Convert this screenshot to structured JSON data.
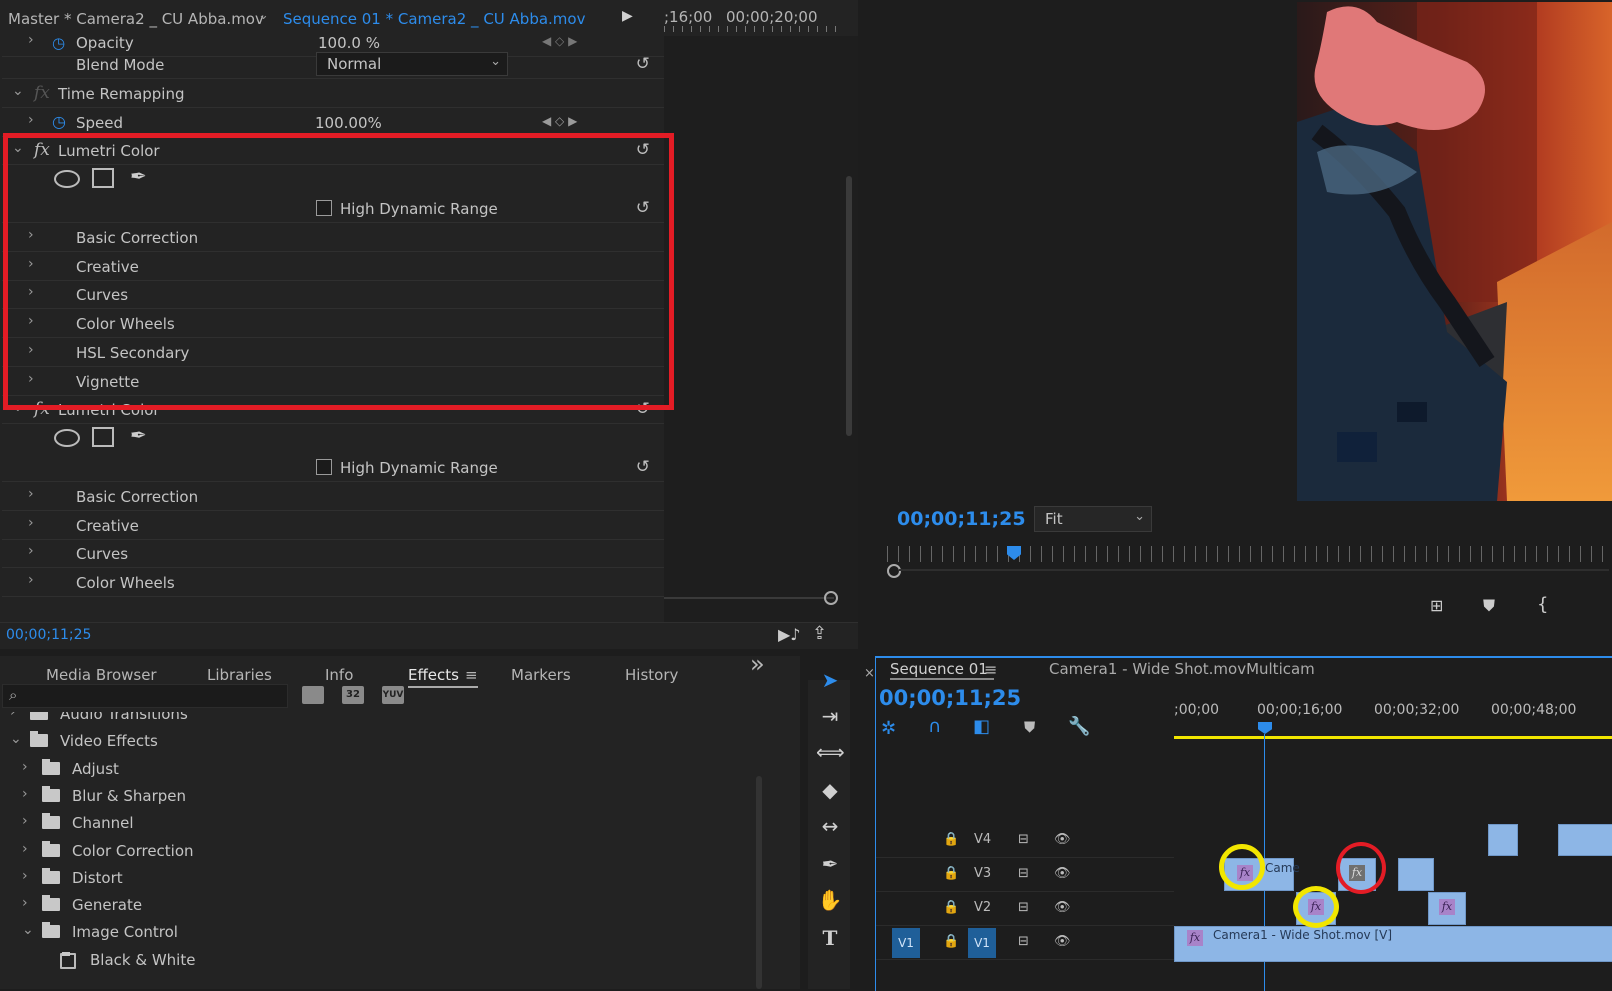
{
  "effect_controls": {
    "tabs": {
      "master": "Master * Camera2 _ CU Abba.mov",
      "sequence": "Sequence 01 * Camera2 _ CU Abba.mov"
    },
    "ruler": {
      "t1": ";16;00",
      "t2": "00;00;20;00"
    },
    "opacity": {
      "label": "Opacity",
      "value": "100.0 %"
    },
    "blend_mode": {
      "label": "Blend Mode",
      "value": "Normal"
    },
    "time_remapping": {
      "label": "Time Remapping"
    },
    "speed": {
      "label": "Speed",
      "value": "100.00%"
    },
    "lumetri_1": {
      "title": "Lumetri Color",
      "hdr_label": "High Dynamic Range",
      "sections": [
        "Basic Correction",
        "Creative",
        "Curves",
        "Color Wheels",
        "HSL Secondary",
        "Vignette"
      ]
    },
    "lumetri_2": {
      "title": "Lumetri Color",
      "hdr_label": "High Dynamic Range",
      "sections": [
        "Basic Correction",
        "Creative",
        "Curves",
        "Color Wheels"
      ]
    },
    "timecode": "00;00;11;25"
  },
  "program_monitor": {
    "timecode": "00;00;11;25",
    "zoom": "Fit"
  },
  "effects_panel": {
    "tabs": [
      "Media Browser",
      "Libraries",
      "Info",
      "Effects",
      "Markers",
      "History"
    ],
    "active_tab": "Effects",
    "search_placeholder": "",
    "preset_buttons": [
      "32",
      "YUV"
    ],
    "tree": [
      {
        "label": "Audio Transitions",
        "level": 0
      },
      {
        "label": "Video Effects",
        "level": 0
      },
      {
        "label": "Adjust",
        "level": 1
      },
      {
        "label": "Blur & Sharpen",
        "level": 1
      },
      {
        "label": "Channel",
        "level": 1
      },
      {
        "label": "Color Correction",
        "level": 1
      },
      {
        "label": "Distort",
        "level": 1
      },
      {
        "label": "Generate",
        "level": 1
      },
      {
        "label": "Image Control",
        "level": 1
      },
      {
        "label": "Black & White",
        "level": 2
      }
    ]
  },
  "timeline": {
    "tab": "Sequence 01",
    "other_tab": "Camera1 - Wide Shot.movMulticam",
    "timecode": "00;00;11;25",
    "ruler": [
      ";00;00",
      "00;00;16;00",
      "00;00;32;00",
      "00;00;48;00"
    ],
    "tracks": [
      "V4",
      "V3",
      "V2",
      "V1"
    ],
    "source_patch": "V1",
    "clips": {
      "v3_label": "Came",
      "v1_label": "Camera1 - Wide Shot.mov [V]"
    },
    "colors": {
      "accent": "#2d8ceb",
      "clip": "#8db6e6",
      "fx_badge": "#a883c9",
      "highlight_red": "#e31c25",
      "highlight_yellow": "#f2e600"
    }
  }
}
